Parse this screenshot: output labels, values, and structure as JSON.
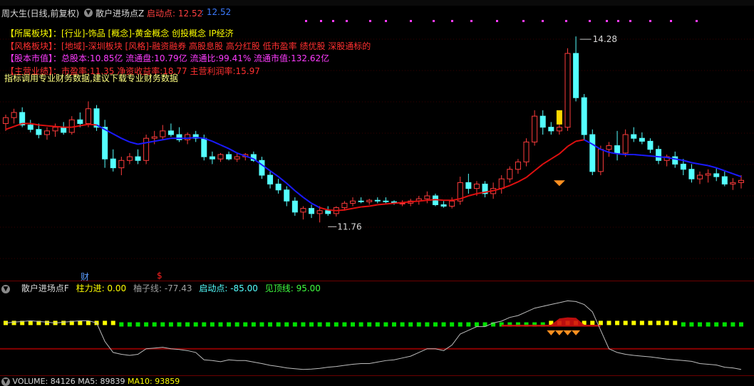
{
  "title_bar": {
    "stock_label": "周大生(日线,前复权)",
    "indicator_name": "散户进场点Z",
    "start_point_label": "启动点: 12.52",
    "start_point_value": ": 12.52"
  },
  "info_panel": {
    "sector_label": "【所属板块】",
    "sector_text": "：[行业]-饰品 [概念]-黄金概念 创投概念 IP经济",
    "style_label": "【风格板块】",
    "style_text": "：[地域]-深圳板块 [风格]-融资融券 高股息股 高分红股 低市盈率 绩优股 深股通标的",
    "cap_label": "【股本市值】",
    "cap_text": "：总股本:10.85亿 流通盘:10.79亿 流通比:99.41% 流通市值:132.62亿",
    "perf_label": "【主营业绩】",
    "perf_text": "：市盈率:11.35 净资收益率:18.77 主营利润率:15.97",
    "overlay_note": "指标调用专业财务数据,建议下载专业财务数据"
  },
  "price_markers": {
    "high_label": "14.28",
    "low_label": "11.76"
  },
  "event_markers": {
    "finance_label": "财",
    "dividend_label": "$"
  },
  "indicator_bar": {
    "name": "散户进场点F",
    "pillar_label": "柱力进: 0.00",
    "grapefruit_label": "柚子线: -77.43",
    "start_label": "启动点: -85.00",
    "top_label": "见顶线: 95.00"
  },
  "volume_bar": {
    "vol_label": "VOLUME: 84126",
    "ma5_label": "MA5: 89839",
    "ma10_label": "MA10: 93859"
  },
  "colors": {
    "up": "#ff3c3c",
    "down": "#54ffff",
    "ma_red": "#e01010",
    "ma_blue": "#1a1aff",
    "yellow": "#ffff00",
    "green": "#00e000",
    "magenta": "#ff3cff"
  },
  "chart_data": {
    "type": "candlestick",
    "x": [
      1,
      2,
      3,
      4,
      5,
      6,
      7,
      8,
      9,
      10,
      11,
      12,
      13,
      14,
      15,
      16,
      17,
      18,
      19,
      20,
      21,
      22,
      23,
      24,
      25,
      26,
      27,
      28,
      29,
      30,
      31,
      32,
      33,
      34,
      35,
      36,
      37,
      38,
      39,
      40,
      41,
      42,
      43,
      44,
      45,
      46,
      47,
      48,
      49,
      50,
      51,
      52,
      53,
      54,
      55,
      56,
      57,
      58,
      59,
      60,
      61,
      62,
      63,
      64,
      65,
      66,
      67,
      68,
      69,
      70,
      71,
      72,
      73,
      74,
      75,
      76,
      77,
      78,
      79,
      80,
      81,
      82,
      83,
      84,
      85,
      86,
      87,
      88,
      89,
      90
    ],
    "ohlc": [
      [
        13.1,
        13.22,
        13.0,
        13.18
      ],
      [
        13.18,
        13.3,
        13.1,
        13.25
      ],
      [
        13.25,
        13.32,
        13.05,
        13.08
      ],
      [
        13.08,
        13.15,
        12.98,
        13.02
      ],
      [
        13.02,
        13.1,
        12.9,
        12.95
      ],
      [
        12.95,
        13.05,
        12.88,
        13.0
      ],
      [
        13.0,
        13.1,
        12.92,
        13.05
      ],
      [
        13.05,
        13.12,
        12.95,
        12.98
      ],
      [
        12.98,
        13.2,
        12.95,
        13.15
      ],
      [
        13.15,
        13.25,
        13.05,
        13.1
      ],
      [
        13.1,
        13.4,
        13.05,
        13.3
      ],
      [
        13.3,
        13.35,
        13.0,
        13.05
      ],
      [
        13.05,
        13.15,
        12.5,
        12.62
      ],
      [
        12.62,
        12.75,
        12.45,
        12.5
      ],
      [
        12.5,
        12.65,
        12.4,
        12.6
      ],
      [
        12.6,
        12.7,
        12.55,
        12.65
      ],
      [
        12.65,
        12.75,
        12.55,
        12.6
      ],
      [
        12.6,
        12.95,
        12.55,
        12.9
      ],
      [
        12.9,
        13.0,
        12.82,
        12.92
      ],
      [
        12.92,
        13.08,
        12.88,
        13.0
      ],
      [
        13.0,
        13.1,
        12.92,
        12.95
      ],
      [
        12.95,
        13.05,
        12.85,
        12.88
      ],
      [
        12.88,
        12.98,
        12.82,
        12.95
      ],
      [
        12.95,
        13.0,
        12.85,
        12.9
      ],
      [
        12.9,
        12.95,
        12.6,
        12.65
      ],
      [
        12.65,
        12.72,
        12.55,
        12.62
      ],
      [
        12.62,
        12.7,
        12.58,
        12.68
      ],
      [
        12.68,
        12.72,
        12.6,
        12.62
      ],
      [
        12.62,
        12.7,
        12.58,
        12.65
      ],
      [
        12.65,
        12.7,
        12.6,
        12.68
      ],
      [
        12.68,
        12.72,
        12.58,
        12.6
      ],
      [
        12.6,
        12.65,
        12.35,
        12.4
      ],
      [
        12.4,
        12.45,
        12.22,
        12.28
      ],
      [
        12.28,
        12.35,
        12.15,
        12.2
      ],
      [
        12.2,
        12.25,
        11.98,
        12.05
      ],
      [
        12.05,
        12.1,
        11.85,
        11.9
      ],
      [
        11.9,
        11.98,
        11.8,
        11.95
      ],
      [
        11.95,
        12.0,
        11.82,
        11.88
      ],
      [
        11.88,
        11.98,
        11.76,
        11.92
      ],
      [
        11.92,
        11.98,
        11.85,
        11.88
      ],
      [
        11.88,
        11.98,
        11.84,
        11.96
      ],
      [
        11.96,
        12.05,
        11.92,
        12.02
      ],
      [
        12.02,
        12.1,
        11.98,
        12.05
      ],
      [
        12.05,
        12.1,
        12.02,
        12.04
      ],
      [
        12.04,
        12.08,
        12.0,
        12.06
      ],
      [
        12.06,
        12.1,
        12.02,
        12.05
      ],
      [
        12.05,
        12.1,
        12.02,
        12.04
      ],
      [
        12.04,
        12.06,
        12.0,
        12.02
      ],
      [
        12.02,
        12.06,
        11.98,
        12.02
      ],
      [
        12.02,
        12.08,
        11.98,
        12.05
      ],
      [
        12.05,
        12.12,
        12.0,
        12.08
      ],
      [
        12.08,
        12.18,
        12.02,
        12.12
      ],
      [
        12.12,
        12.15,
        11.98,
        12.0
      ],
      [
        12.0,
        12.05,
        11.96,
        11.98
      ],
      [
        11.98,
        12.1,
        11.95,
        12.05
      ],
      [
        12.05,
        12.38,
        12.0,
        12.3
      ],
      [
        12.3,
        12.42,
        12.15,
        12.22
      ],
      [
        12.22,
        12.32,
        12.12,
        12.28
      ],
      [
        12.28,
        12.32,
        12.1,
        12.15
      ],
      [
        12.15,
        12.3,
        12.08,
        12.22
      ],
      [
        12.22,
        12.4,
        12.15,
        12.35
      ],
      [
        12.35,
        12.52,
        12.3,
        12.48
      ],
      [
        12.48,
        12.62,
        12.42,
        12.58
      ],
      [
        12.58,
        12.9,
        12.52,
        12.85
      ],
      [
        12.85,
        13.28,
        12.8,
        13.2
      ],
      [
        13.2,
        13.28,
        12.95,
        13.05
      ],
      [
        13.05,
        13.12,
        12.95,
        13.0
      ],
      [
        13.0,
        13.12,
        12.95,
        13.05
      ],
      [
        13.05,
        14.12,
        13.0,
        14.05
      ],
      [
        14.05,
        14.28,
        13.4,
        13.45
      ],
      [
        13.45,
        13.5,
        12.88,
        12.95
      ],
      [
        12.95,
        13.02,
        12.4,
        12.45
      ],
      [
        12.45,
        12.8,
        12.4,
        12.75
      ],
      [
        12.75,
        12.85,
        12.65,
        12.8
      ],
      [
        12.8,
        13.0,
        12.6,
        12.7
      ],
      [
        12.7,
        13.02,
        12.65,
        12.95
      ],
      [
        12.95,
        13.05,
        12.85,
        12.9
      ],
      [
        12.9,
        12.98,
        12.82,
        12.86
      ],
      [
        12.86,
        12.9,
        12.7,
        12.75
      ],
      [
        12.75,
        12.8,
        12.55,
        12.6
      ],
      [
        12.6,
        12.68,
        12.52,
        12.65
      ],
      [
        12.65,
        12.72,
        12.5,
        12.55
      ],
      [
        12.55,
        12.62,
        12.4,
        12.48
      ],
      [
        12.48,
        12.55,
        12.3,
        12.35
      ],
      [
        12.35,
        12.45,
        12.28,
        12.4
      ],
      [
        12.4,
        12.48,
        12.3,
        12.42
      ],
      [
        12.42,
        12.5,
        12.32,
        12.38
      ],
      [
        12.38,
        12.45,
        12.25,
        12.28
      ],
      [
        12.28,
        12.36,
        12.2,
        12.3
      ],
      [
        12.3,
        12.4,
        12.22,
        12.33
      ]
    ],
    "ma": [
      13.02,
      13.06,
      13.1,
      13.1,
      13.08,
      13.07,
      13.06,
      13.05,
      13.05,
      13.07,
      13.09,
      13.08,
      13.02,
      12.96,
      12.9,
      12.85,
      12.82,
      12.84,
      12.86,
      12.88,
      12.9,
      12.9,
      12.9,
      12.91,
      12.9,
      12.86,
      12.81,
      12.76,
      12.7,
      12.66,
      12.62,
      12.54,
      12.46,
      12.38,
      12.29,
      12.19,
      12.1,
      12.02,
      11.96,
      11.93,
      11.92,
      11.93,
      11.95,
      11.97,
      11.98,
      12.0,
      12.01,
      12.02,
      12.03,
      12.04,
      12.05,
      12.06,
      12.07,
      12.06,
      12.06,
      12.08,
      12.12,
      12.15,
      12.17,
      12.19,
      12.22,
      12.26,
      12.31,
      12.37,
      12.46,
      12.55,
      12.62,
      12.69,
      12.79,
      12.86,
      12.88,
      12.82,
      12.75,
      12.71,
      12.69,
      12.68,
      12.68,
      12.67,
      12.66,
      12.65,
      12.64,
      12.62,
      12.6,
      12.57,
      12.55,
      12.53,
      12.5,
      12.46,
      12.42,
      12.38
    ],
    "ma_color_switch_index": 70,
    "high_point": {
      "index": 70,
      "value": 14.28
    },
    "low_point": {
      "index": 39,
      "value": 11.76
    },
    "ylim": [
      11.3,
      14.6
    ],
    "indicator": {
      "ylim": [
        -100,
        120
      ],
      "line": [
        40,
        42,
        44,
        46,
        44,
        42,
        40,
        42,
        44,
        46,
        46,
        40,
        -10,
        -40,
        -45,
        -48,
        -45,
        -30,
        -28,
        -26,
        -30,
        -32,
        -35,
        -40,
        -60,
        -62,
        -65,
        -60,
        -62,
        -62,
        -66,
        -70,
        -75,
        -78,
        -82,
        -84,
        -86,
        -85,
        -83,
        -80,
        -78,
        -75,
        -72,
        -70,
        -70,
        -66,
        -62,
        -60,
        -55,
        -50,
        -40,
        -30,
        -30,
        -35,
        -20,
        10,
        20,
        30,
        30,
        40,
        45,
        55,
        60,
        70,
        80,
        85,
        90,
        95,
        100,
        98,
        90,
        70,
        20,
        -30,
        -40,
        -45,
        -48,
        -50,
        -52,
        -55,
        -58,
        -60,
        -62,
        -64,
        -70,
        -72,
        -74,
        -80,
        -82,
        -86
      ],
      "yellow_line": 40,
      "green_line": 36,
      "red_line": -30
    }
  }
}
